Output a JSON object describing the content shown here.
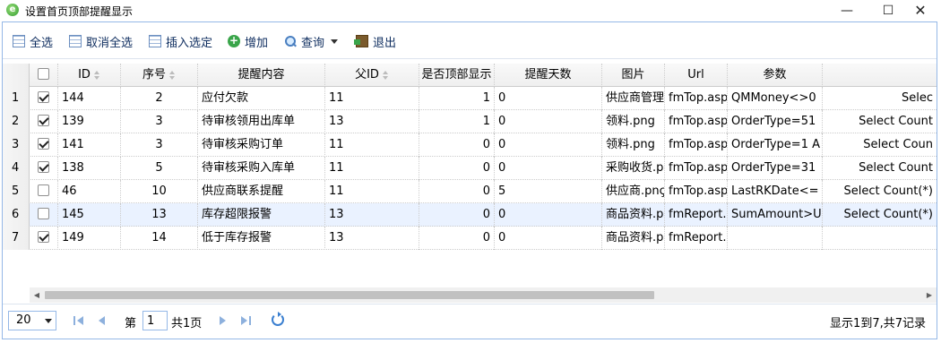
{
  "window": {
    "title": "设置首页顶部提醒显示",
    "minimize": "—",
    "maximize": "☐",
    "close": "✕"
  },
  "toolbar": {
    "select_all": "全选",
    "deselect_all": "取消全选",
    "insert_selected": "插入选定",
    "add": "增加",
    "query": "查询",
    "exit": "退出"
  },
  "grid": {
    "columns": [
      "ID",
      "序号",
      "提醒内容",
      "父ID",
      "是否顶部显示",
      "提醒天数",
      "图片",
      "Url",
      "参数",
      ""
    ],
    "rows": [
      {
        "rownum": "1",
        "checked": true,
        "id": "144",
        "seq": "2",
        "content": "应付欠款",
        "parent": "11",
        "top": "1",
        "days": "0",
        "image": "供应商管理",
        "url": "fmTop.asp",
        "param": "QMMoney<>0",
        "extra": "Selec"
      },
      {
        "rownum": "2",
        "checked": true,
        "id": "139",
        "seq": "3",
        "content": "待审核领用出库单",
        "parent": "13",
        "top": "1",
        "days": "0",
        "image": "领料.png",
        "url": "fmTop.asp",
        "param": "OrderType=51",
        "extra": "Select Count"
      },
      {
        "rownum": "3",
        "checked": true,
        "id": "141",
        "seq": "3",
        "content": "待审核采购订单",
        "parent": "11",
        "top": "0",
        "days": "0",
        "image": "领料.png",
        "url": "fmTop.asp",
        "param": "OrderType=1 A",
        "extra": "Select Coun"
      },
      {
        "rownum": "4",
        "checked": true,
        "id": "138",
        "seq": "5",
        "content": "待审核采购入库单",
        "parent": "11",
        "top": "0",
        "days": "0",
        "image": "采购收货.p",
        "url": "fmTop.asp",
        "param": "OrderType=31",
        "extra": "Select Count"
      },
      {
        "rownum": "5",
        "checked": false,
        "id": "46",
        "seq": "10",
        "content": "供应商联系提醒",
        "parent": "11",
        "top": "0",
        "days": "5",
        "image": "供应商.pnç",
        "url": "fmTop.asp",
        "param": "LastRKDate<= -",
        "extra": "Select Count(*)"
      },
      {
        "rownum": "6",
        "checked": false,
        "id": "145",
        "seq": "13",
        "content": "库存超限报警",
        "parent": "13",
        "top": "0",
        "days": "0",
        "image": "商品资料.p",
        "url": "fmReport.",
        "param": "SumAmount>Up",
        "extra": "Select Count(*)"
      },
      {
        "rownum": "7",
        "checked": true,
        "id": "149",
        "seq": "14",
        "content": "低于库存报警",
        "parent": "13",
        "top": "0",
        "days": "0",
        "image": "商品资料.p",
        "url": "fmReport.",
        "param": "",
        "extra": ""
      }
    ]
  },
  "pager": {
    "page_size": "20",
    "page_prefix": "第",
    "page_value": "1",
    "page_total": "共1页",
    "info": "显示1到7,共7记录"
  },
  "colors": {
    "accent": "#95b8e7",
    "toolbar_text": "#0e2d5f",
    "selected_row": "#eaf2ff"
  }
}
